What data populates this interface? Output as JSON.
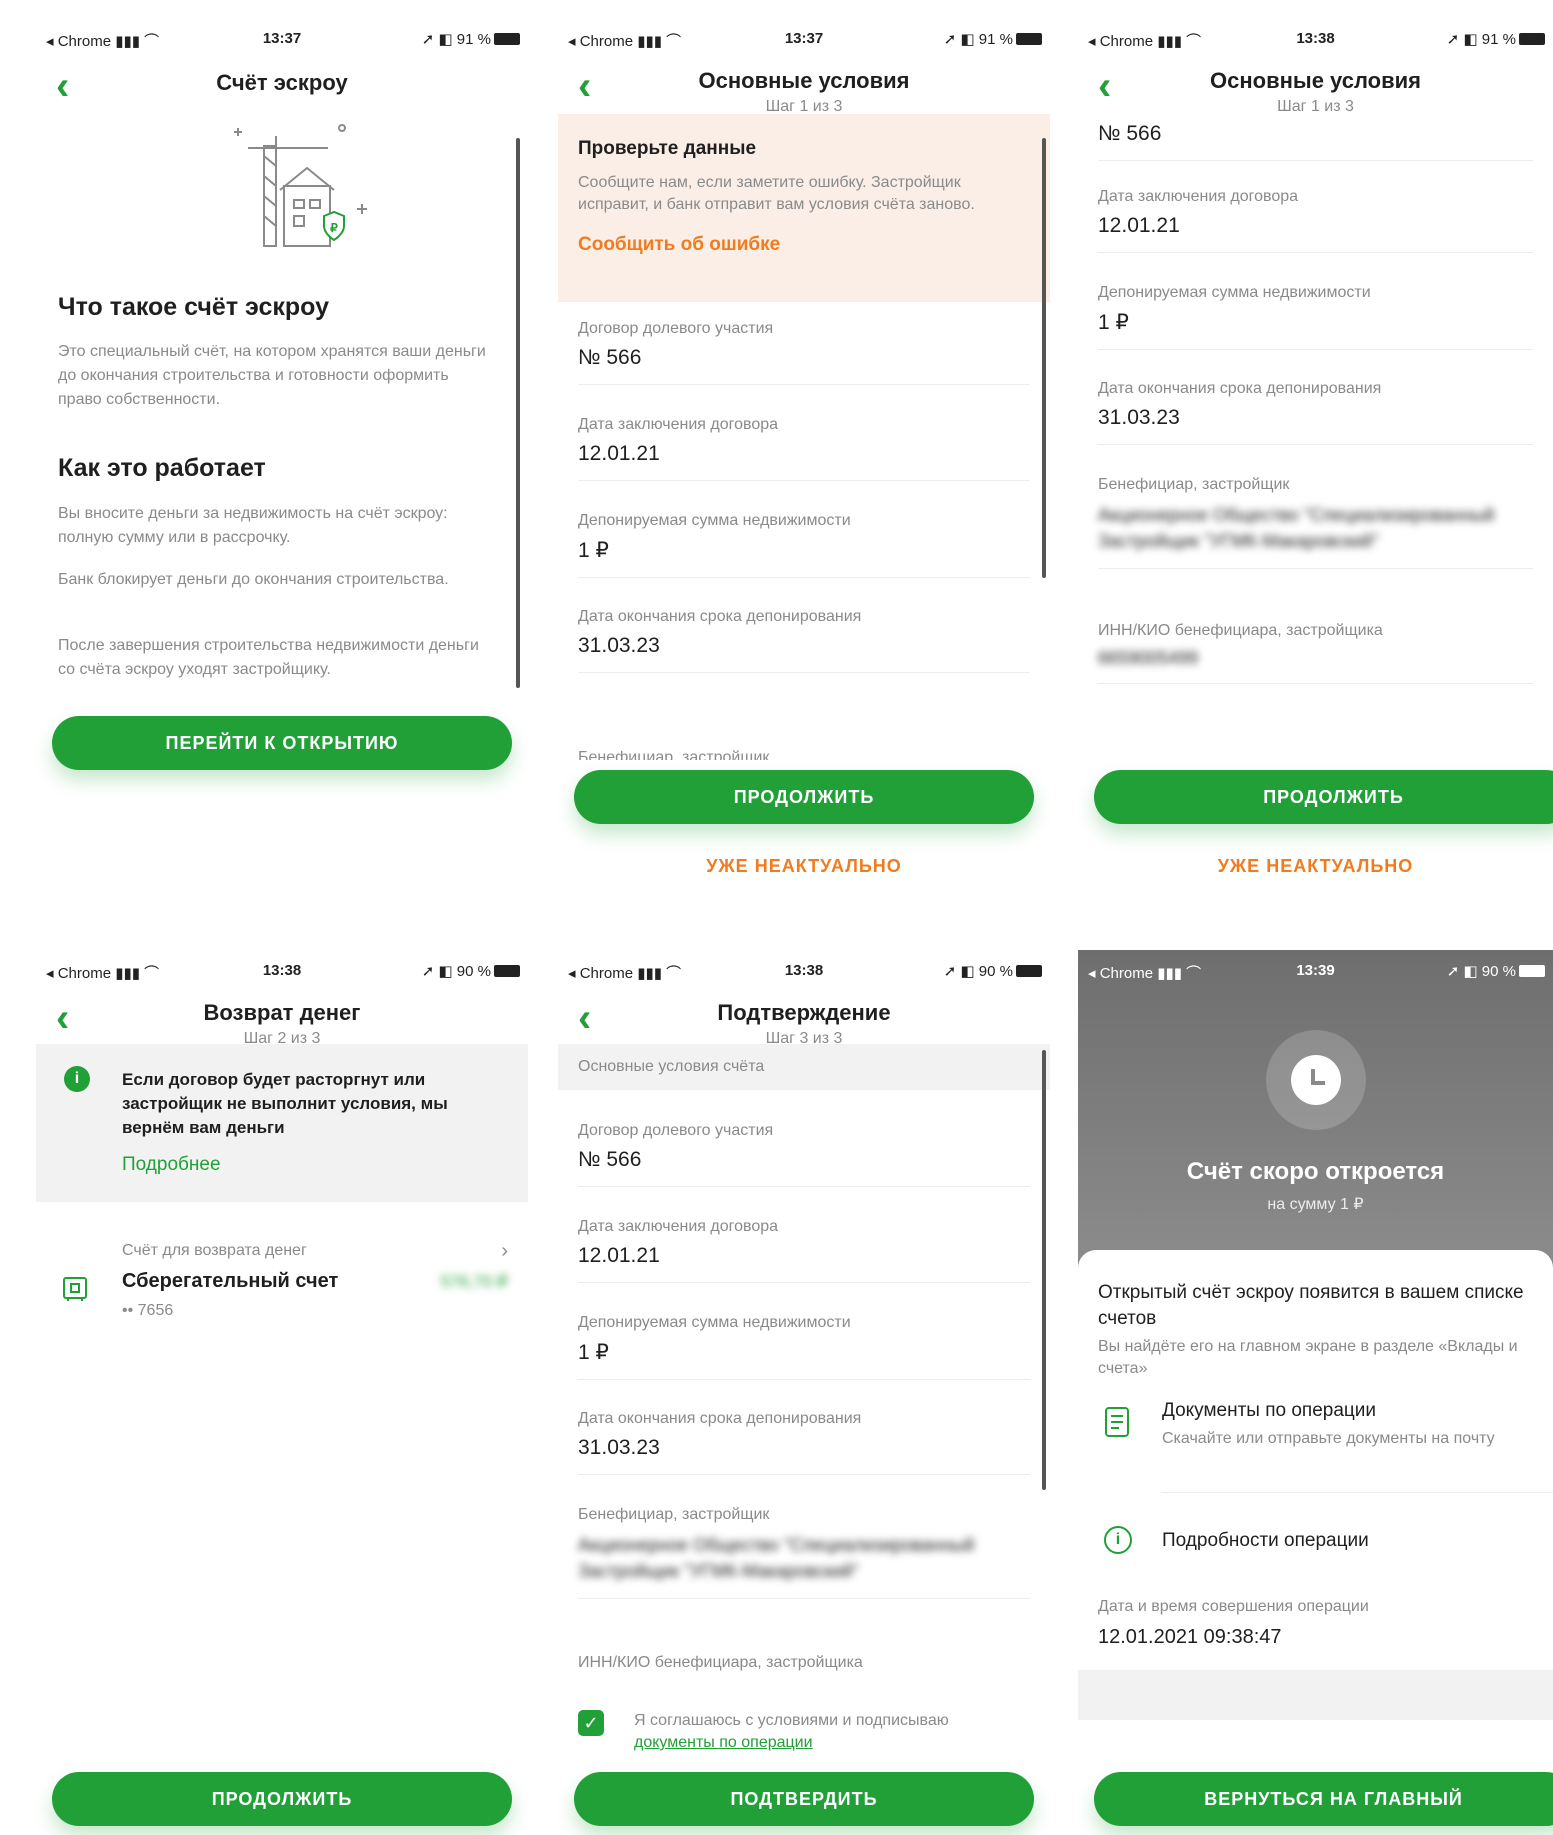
{
  "status": {
    "carrier": "◂ Chrome ▮▮▮ ⌒",
    "t1": "13:37",
    "t2": "13:37",
    "t3": "13:38",
    "t4": "13:38",
    "t5": "13:38",
    "t6": "13:39",
    "bat91": "➚ ◧ 91 %",
    "bat90": "➚ ◧ 90 %"
  },
  "screen1": {
    "title": "Счёт эскроу",
    "h_what": "Что такое счёт эскроу",
    "what_text": "Это специальный счёт, на котором хранятся ваши деньги до окончания строительства и готовности оформить право собственности.",
    "h_how": "Как это работает",
    "how_1": "Вы вносите деньги за недвижимость на счёт эскроу: полную сумму или в рассрочку.",
    "how_2": "Банк блокирует деньги до окончания строительства.",
    "how_3": "После завершения строительства недвижимости деньги со счёта эскроу уходят застройщику.",
    "button": "Перейти к открытию"
  },
  "screen2": {
    "title": "Основные условия",
    "step": "Шаг 1 из 3",
    "warn_title": "Проверьте данные",
    "warn_text": "Сообщите нам, если заметите ошибку. Застройщик исправит, и банк отправит вам условия счёта заново.",
    "warn_link": "Сообщить об ошибке",
    "contract_label": "Договор долевого участия",
    "contract_value": "№ 566",
    "date_label": "Дата заключения договора",
    "date_value": "12.01.21",
    "amount_label": "Депонируемая сумма недвижимости",
    "amount_value": "1 ₽",
    "end_label": "Дата окончания срока депонирования",
    "end_value": "31.03.23",
    "benef_label_partial": "Бенефициар, застройщик",
    "continue": "Продолжить",
    "not_relevant": "Уже неактуально"
  },
  "screen3": {
    "title": "Основные условия",
    "step": "Шаг 1 из 3",
    "contract_value": "№ 566",
    "date_label": "Дата заключения договора",
    "date_value": "12.01.21",
    "amount_label": "Депонируемая сумма недвижимости",
    "amount_value": "1 ₽",
    "end_label": "Дата окончания срока депонирования",
    "end_value": "31.03.23",
    "benef_label": "Бенефициар, застройщик",
    "benef_value": "Акционерное Общество \"Специализированный Застройщик \"УГМК-Макаровский\"",
    "inn_label": "ИНН/КИО бенефициара, застройщика",
    "inn_value": "6659005499",
    "continue": "Продолжить",
    "not_relevant": "Уже неактуально"
  },
  "screen4": {
    "title": "Возврат денег",
    "step": "Шаг 2 из 3",
    "info_text": "Если договор будет расторгнут или застройщик не выполнит условия, мы вернём вам деньги",
    "info_link": "Подробнее",
    "account_label": "Счёт для возврата денег",
    "account_name": "Сберегательный счет",
    "account_number": "•• 7656",
    "account_balance": "576,70 ₽",
    "continue": "Продолжить"
  },
  "screen5": {
    "title": "Подтверждение",
    "step": "Шаг 3 из 3",
    "section": "Основные условия счёта",
    "contract_label": "Договор долевого участия",
    "contract_value": "№ 566",
    "date_label": "Дата заключения договора",
    "date_value": "12.01.21",
    "amount_label": "Депонируемая сумма недвижимости",
    "amount_value": "1 ₽",
    "end_label": "Дата окончания срока депонирования",
    "end_value": "31.03.23",
    "benef_label": "Бенефициар, застройщик",
    "benef_value": "Акционерное Общество \"Специализированный Застройщик \"УГМК-Макаровский\"",
    "inn_label": "ИНН/КИО бенефициара, застройщика",
    "agree_text": "Я соглашаюсь с условиями и подписываю",
    "agree_link": "документы по операции",
    "confirm": "Подтвердить"
  },
  "screen6": {
    "title": "Счёт скоро откроется",
    "subtitle": "на сумму 1 ₽",
    "notice_title": "Открытый счёт эскроу появится в вашем списке счетов",
    "notice_text": "Вы найдёте его на главном экране в разделе «Вклады и счета»",
    "docs_title": "Документы по операции",
    "docs_text": "Скачайте или отправьте документы на почту",
    "details": "Подробности операции",
    "datetime_label": "Дата и время совершения операции",
    "datetime_value": "12.01.2021 09:38:47",
    "button": "Вернуться на главный"
  },
  "colors": {
    "brand_green": "#21a038",
    "warning_orange": "#f07c1f",
    "warning_bg": "#fbeee6"
  }
}
